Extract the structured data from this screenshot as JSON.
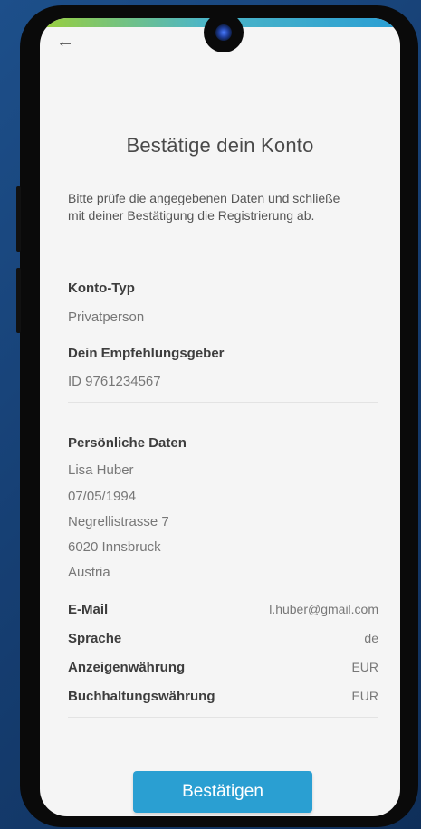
{
  "nav": {
    "back_icon": "arrow-left-icon",
    "back_glyph": "←"
  },
  "page": {
    "title": "Bestätige dein Konto",
    "intro": "Bitte prüfe die angegebenen Daten und schließe mit deiner Bestätigung die Registrierung ab."
  },
  "account": {
    "type_label": "Konto-Typ",
    "type_value": "Privatperson",
    "referrer_label": "Dein Empfehlungsgeber",
    "referrer_value": "ID 9761234567"
  },
  "personal": {
    "label": "Persönliche Daten",
    "name": "Lisa Huber",
    "birthdate": "07/05/1994",
    "street": "Negrellistrasse  7",
    "city": "6020 Innsbruck",
    "country": "Austria"
  },
  "details": [
    {
      "label": "E-Mail",
      "value": "l.huber@gmail.com"
    },
    {
      "label": "Sprache",
      "value": "de"
    },
    {
      "label": "Anzeigenwährung",
      "value": "EUR"
    },
    {
      "label": "Buchhaltungswährung",
      "value": "EUR"
    }
  ],
  "actions": {
    "confirm_label": "Bestätigen"
  },
  "colors": {
    "accent": "#2a9fd2",
    "background": "#f5f5f5",
    "top_bar": [
      "#9bcf3a",
      "#2a9ed4"
    ]
  }
}
